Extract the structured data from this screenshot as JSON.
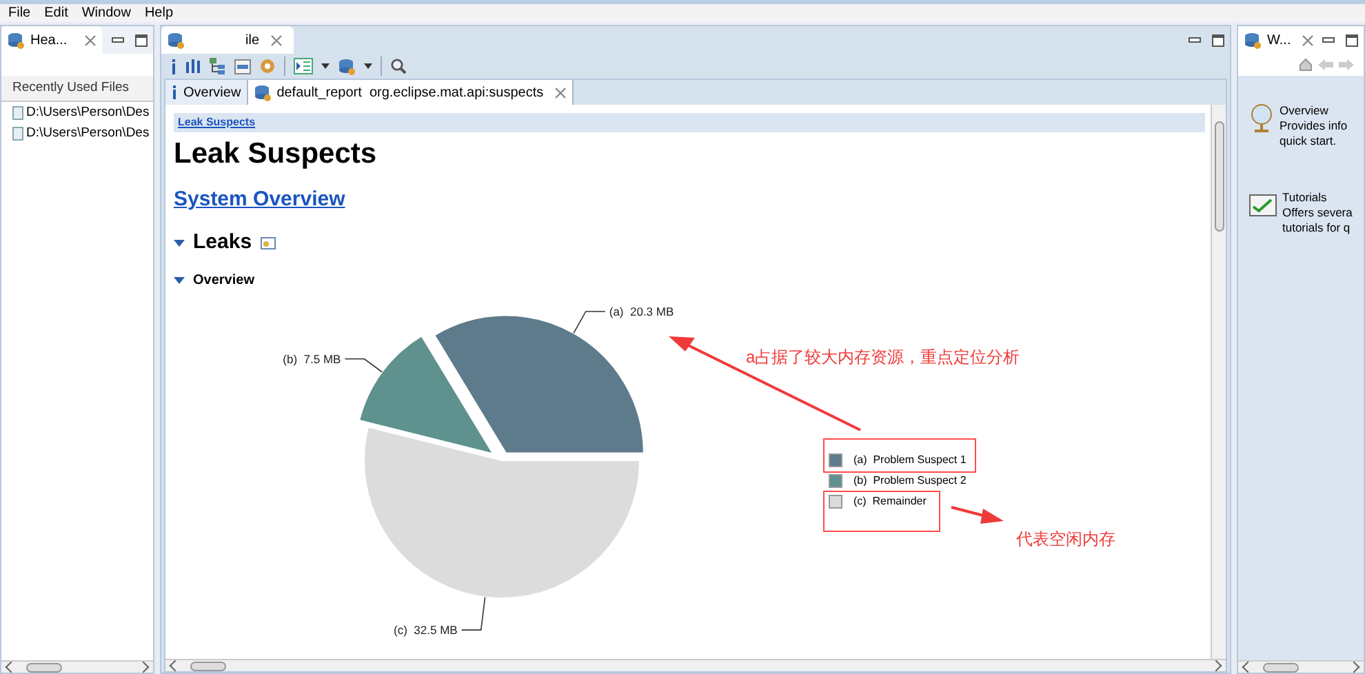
{
  "menu": [
    "File",
    "Edit",
    "Window",
    "Help"
  ],
  "left_panel": {
    "tab": {
      "label": "Hea...",
      "selected": true
    },
    "section_title": "Recently Used Files",
    "files": [
      "D:\\Users\\Person\\Des",
      "D:\\Users\\Person\\Des"
    ]
  },
  "editor": {
    "tab": {
      "label": "ile",
      "selected": true
    },
    "inner_tabs": [
      {
        "label": "Overview",
        "kind": "info",
        "selected": false
      },
      {
        "label": "default_report  org.eclipse.mat.api:suspects",
        "kind": "report",
        "selected": true
      }
    ],
    "report": {
      "breadcrumb": "Leak Suspects",
      "title": "Leak Suspects",
      "link": "System Overview",
      "section": {
        "title": "Leaks",
        "expanded": true
      },
      "subsection": {
        "title": "Overview",
        "expanded": true
      },
      "chart_data": {
        "type": "pie",
        "values": [
          20.3,
          7.5,
          32.5
        ],
        "value_labels": [
          "(a)  20.3 MB",
          "(b)  7.5 MB",
          "(c)  32.5 MB"
        ]
      },
      "legend": [
        {
          "label": "(a)  Problem Suspect 1",
          "color": "#5e7b8b"
        },
        {
          "label": "(b)  Problem Suspect 2",
          "color": "#5f918f"
        },
        {
          "label": "(c)  Remainder",
          "color": "#dcdcdc"
        }
      ],
      "annotations": [
        {
          "text": "a占据了较大内存资源，重点定位分析"
        },
        {
          "text": "代表空闲内存"
        }
      ]
    }
  },
  "right_panel": {
    "tab": {
      "label": "W...",
      "selected": true
    },
    "items": [
      {
        "kind": "globe",
        "title": "Overview",
        "lines": [
          "Provides info",
          "quick start."
        ]
      },
      {
        "kind": "tutorial",
        "title": "Tutorials",
        "lines": [
          "Offers severa",
          "tutorials for q"
        ]
      }
    ]
  }
}
